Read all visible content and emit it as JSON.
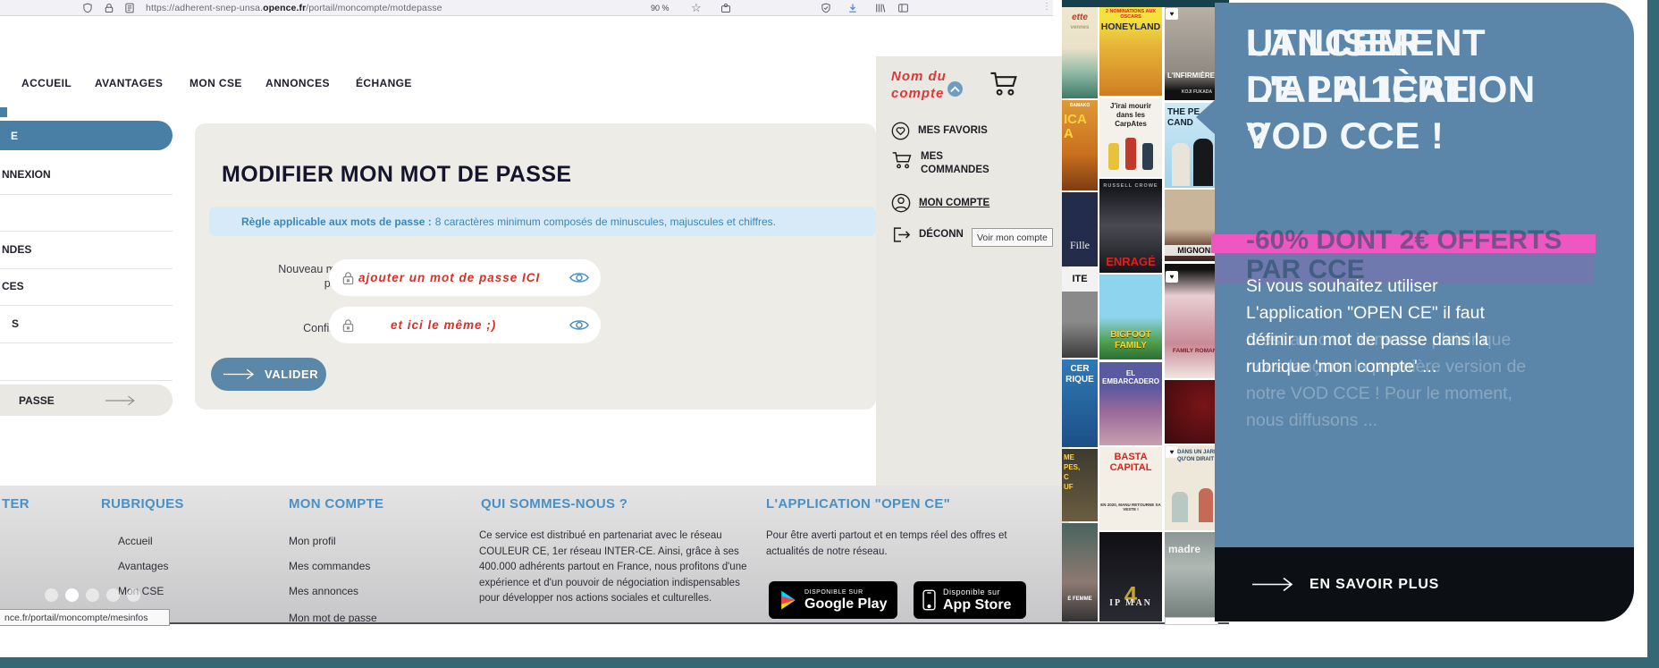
{
  "colors": {
    "steel_blue": "#5b87a8",
    "heading_blue": "#4a90c4",
    "annotation_red": "#d93025",
    "pink_bar": "#ee57c2",
    "teal_frame": "#336874",
    "cta_dark": "#0c1015",
    "info_bg": "#d6ebf7"
  },
  "browser": {
    "url_prefix": "https://adherent-snep-unsa.",
    "url_domain": "opence.fr",
    "url_path": "/portail/moncompte/motdepasse",
    "zoom_level": "90 %",
    "star": "☆",
    "overflow_dots": "⋮",
    "status_tooltip": "nce.fr/portail/moncompte/mesinfos"
  },
  "nav": {
    "items": [
      "ACCUEIL",
      "AVANTAGES",
      "MON CSE",
      "ANNONCES",
      "ÉCHANGE"
    ]
  },
  "sidebar": {
    "active_fragment": "E",
    "items": [
      "NNEXION",
      "NDES",
      "CES",
      "S"
    ],
    "bottom_fragment": "PASSE"
  },
  "account": {
    "name": "Nom du\ncompte",
    "menu": [
      {
        "label": "MES FAVORIS"
      },
      {
        "label": "MES COMMANDES"
      },
      {
        "label": "MON COMPTE"
      },
      {
        "label": "DÉCONN"
      }
    ],
    "tooltip": "Voir mon compte"
  },
  "form": {
    "title": "MODIFIER MON MOT DE PASSE",
    "rule_label": "Règle applicable aux mots de passe :",
    "rule_text": "8 caractères minimum composés de minuscules, majuscules et chiffres.",
    "new_password_label": "Nouveau mot de\npasse :",
    "new_password_annotation": "ajouter un mot de passe ICI",
    "confirm_label": "Confirmez :",
    "confirm_annotation": "et ici le même ;)",
    "submit_label": "VALIDER"
  },
  "footer": {
    "col0_fragment": "TER",
    "rubriques": {
      "title": "RUBRIQUES",
      "items": [
        "Accueil",
        "Avantages",
        "Mon CSE"
      ]
    },
    "compte": {
      "title": "MON COMPTE",
      "items": [
        "Mon profil",
        "Mes commandes",
        "Mes annonces",
        "Mon mot de passe"
      ]
    },
    "about": {
      "title": "QUI SOMMES-NOUS ?",
      "text": "Ce service est distribué en partenariat avec le réseau COULEUR CE, 1er réseau INTER-CE. Ainsi, grâce à ses 400.000 adhérents partout en France, nous profitons d'une expérience et d'un pouvoir de négociation indispensables pour développer nos actions sociales et culturelles."
    },
    "app": {
      "title": "L'APPLICATION \"OPEN CE\"",
      "text": "Pour être averti partout et en temps réel des offres et actualités de notre réseau."
    },
    "badges": {
      "gp_small": "DISPONIBLE SUR",
      "gp_big": "Google Play",
      "as_small": "Disponible sur",
      "as_big": "App Store"
    }
  },
  "promo": {
    "ghost_title": "LANCEMENT\nDE LA 1ÈRE\nVOD CCE !",
    "title": "UTILISER\nL'APPLICATION\n?",
    "ghost_offer": "-60% DONT 2€ OFFERTS\nPAR CCE",
    "text": "Si vous souhaitez utiliser\nL'application \"OPEN CE\" il faut\ndéfinir un mot de passe dans la\nrubrique 'mon compte' ...",
    "ghost_text": "C'est avec un immense plaisir que\nnous lançons la première version de\nnotre VOD CCE ! Pour le moment,\nnous diffusons ...",
    "cta": "EN SAVOIR PLUS"
  },
  "vod": {
    "posters": [
      {
        "t": "ette",
        "s": "vennes"
      },
      {
        "t": "ICA\nA",
        "s": "BAMAKO"
      },
      {
        "t": "Fille"
      },
      {
        "t": "ITE"
      },
      {
        "t": "CER\nRIQUE"
      },
      {
        "t": "ME\nPES,\nC\nUF"
      },
      {
        "t": "E FEMME"
      },
      {
        "t": "HONEYLAND",
        "s": "2 NOMINATIONS AUX OSCARS"
      },
      {
        "t": "J'irai mourir dans les CarpAtes"
      },
      {
        "t": "ENRAGÉ",
        "s": "RUSSELL CROWE"
      },
      {
        "t": "BIGFOOT\nFAMILY"
      },
      {
        "t": "EL EMBARCADERO"
      },
      {
        "t": "BASTA\nCAPITAL",
        "s": "EN 2020, MANU RETOURNE SA VESTE !"
      },
      {
        "t": "IP MAN",
        "s": "4"
      },
      {
        "t": "L'INFIRMIÈRE",
        "s": "KOJI FUKADA"
      },
      {
        "t": "THE PE\nCAND"
      },
      {
        "t": "MIGNONN"
      },
      {
        "t": "FAMILY ROMANC"
      },
      {
        "t": ""
      },
      {
        "t": "DANS UN JARD\nQU'ON DIRAIT ÉTE"
      },
      {
        "t": "madre"
      }
    ],
    "heart": "♥"
  }
}
